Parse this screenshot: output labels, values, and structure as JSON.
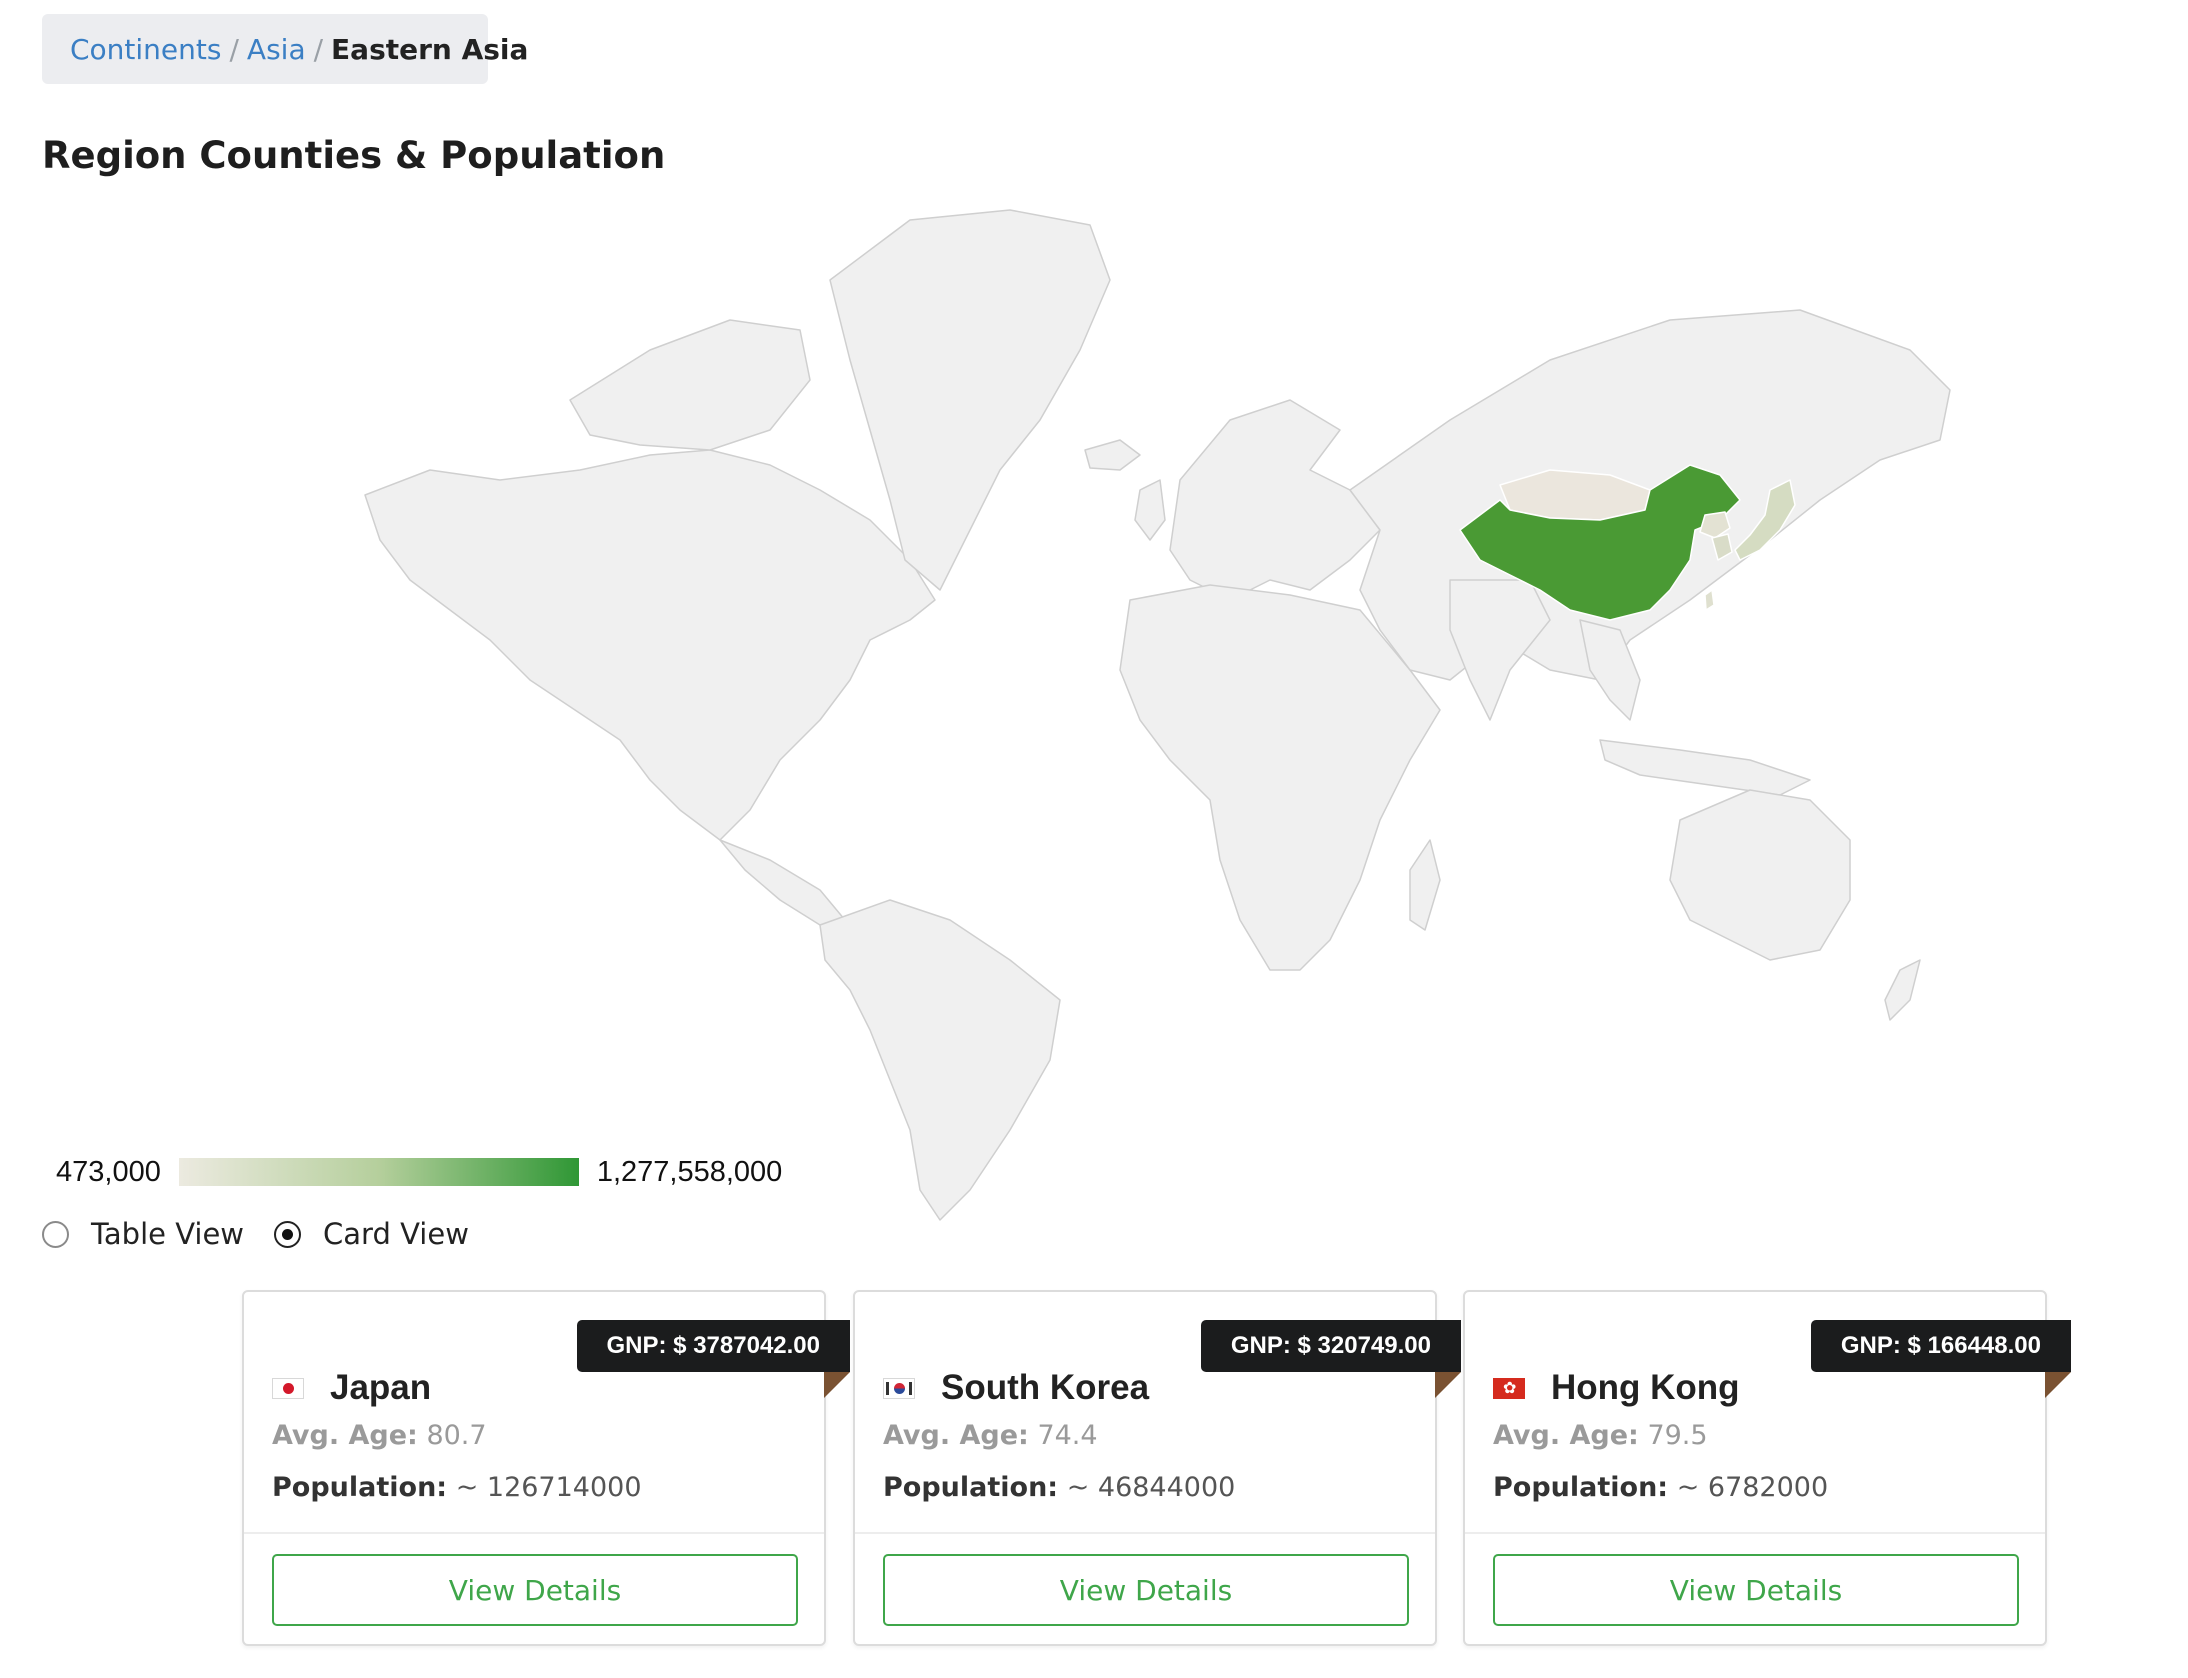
{
  "breadcrumb": {
    "items": [
      "Continents",
      "Asia"
    ],
    "separator": "/",
    "current": "Eastern Asia"
  },
  "page_title": "Region Counties & Population",
  "legend": {
    "min_label": "473,000",
    "max_label": "1,277,558,000",
    "min_color": "#eceae0",
    "max_color": "#2f9735"
  },
  "map": {
    "base_color": "#f0f0f0",
    "border_color": "#cfcfcf",
    "highlighted": [
      {
        "name": "China",
        "color": "#4a9a34"
      },
      {
        "name": "Mongolia",
        "color": "#ebe6dd"
      },
      {
        "name": "Japan",
        "color": "#d5dcc2"
      },
      {
        "name": "South Korea",
        "color": "#d9dcc8"
      },
      {
        "name": "North Korea",
        "color": "#e3e2d3"
      },
      {
        "name": "Taiwan",
        "color": "#dfe0cf"
      }
    ]
  },
  "view_toggle": {
    "options": [
      "Table View",
      "Card View"
    ],
    "selected": "Card View"
  },
  "cards": [
    {
      "gnp": "GNP: $ 3787042.00",
      "flag_icon": "japan-flag-icon",
      "name": "Japan",
      "age_label": "Avg. Age:",
      "age_value": "80.7",
      "population_label": "Population:",
      "population_value": "~ 126714000",
      "button": "View Details"
    },
    {
      "gnp": "GNP: $ 320749.00",
      "flag_icon": "south-korea-flag-icon",
      "name": "South Korea",
      "age_label": "Avg. Age:",
      "age_value": "74.4",
      "population_label": "Population:",
      "population_value": "~ 46844000",
      "button": "View Details"
    },
    {
      "gnp": "GNP: $ 166448.00",
      "flag_icon": "hong-kong-flag-icon",
      "name": "Hong Kong",
      "age_label": "Avg. Age:",
      "age_value": "79.5",
      "population_label": "Population:",
      "population_value": "~ 6782000",
      "button": "View Details"
    }
  ],
  "colors": {
    "accent_green": "#3fa64a",
    "link_blue": "#3b7fc4",
    "badge_dark": "#1b1c1d"
  }
}
